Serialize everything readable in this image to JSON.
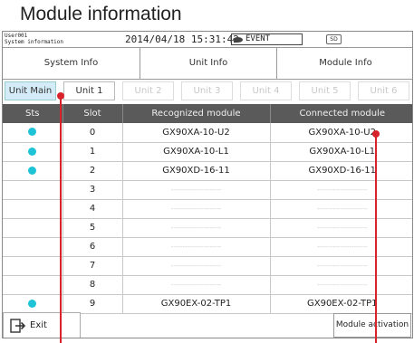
{
  "heading": "Module information",
  "statusbar": {
    "user": "User001",
    "screen": "System information",
    "datetime": "2014/04/18 15:31:42",
    "event": "EVENT",
    "sd": "SD"
  },
  "main_tabs": [
    {
      "label": "System Info",
      "active": false
    },
    {
      "label": "Unit Info",
      "active": false
    },
    {
      "label": "Module Info",
      "active": true
    }
  ],
  "unit_tabs": [
    {
      "label": "Unit Main",
      "state": "active"
    },
    {
      "label": "Unit 1",
      "state": "normal"
    },
    {
      "label": "Unit 2",
      "state": "disabled"
    },
    {
      "label": "Unit 3",
      "state": "disabled"
    },
    {
      "label": "Unit 4",
      "state": "disabled"
    },
    {
      "label": "Unit 5",
      "state": "disabled"
    },
    {
      "label": "Unit 6",
      "state": "disabled"
    }
  ],
  "table": {
    "headers": [
      "Sts",
      "Slot",
      "Recognized module",
      "Connected module"
    ],
    "empty_placeholder": "----------------------",
    "rows": [
      {
        "status": true,
        "slot": "0",
        "recognized": "GX90XA-10-U2",
        "connected": "GX90XA-10-U2"
      },
      {
        "status": true,
        "slot": "1",
        "recognized": "GX90XA-10-L1",
        "connected": "GX90XA-10-L1"
      },
      {
        "status": true,
        "slot": "2",
        "recognized": "GX90XD-16-11",
        "connected": "GX90XD-16-11"
      },
      {
        "status": false,
        "slot": "3",
        "recognized": "",
        "connected": ""
      },
      {
        "status": false,
        "slot": "4",
        "recognized": "",
        "connected": ""
      },
      {
        "status": false,
        "slot": "5",
        "recognized": "",
        "connected": ""
      },
      {
        "status": false,
        "slot": "6",
        "recognized": "",
        "connected": ""
      },
      {
        "status": false,
        "slot": "7",
        "recognized": "",
        "connected": ""
      },
      {
        "status": false,
        "slot": "8",
        "recognized": "",
        "connected": ""
      },
      {
        "status": true,
        "slot": "9",
        "recognized": "GX90EX-02-TP1",
        "connected": "GX90EX-02-TP1"
      }
    ]
  },
  "buttons": {
    "exit": "Exit",
    "activate": "Module activation"
  },
  "colors": {
    "status_ok": "#1ec3d7",
    "active_tab": "#d4ecf8",
    "header_bg": "#5a5a5a",
    "callout": "#d8232a"
  }
}
